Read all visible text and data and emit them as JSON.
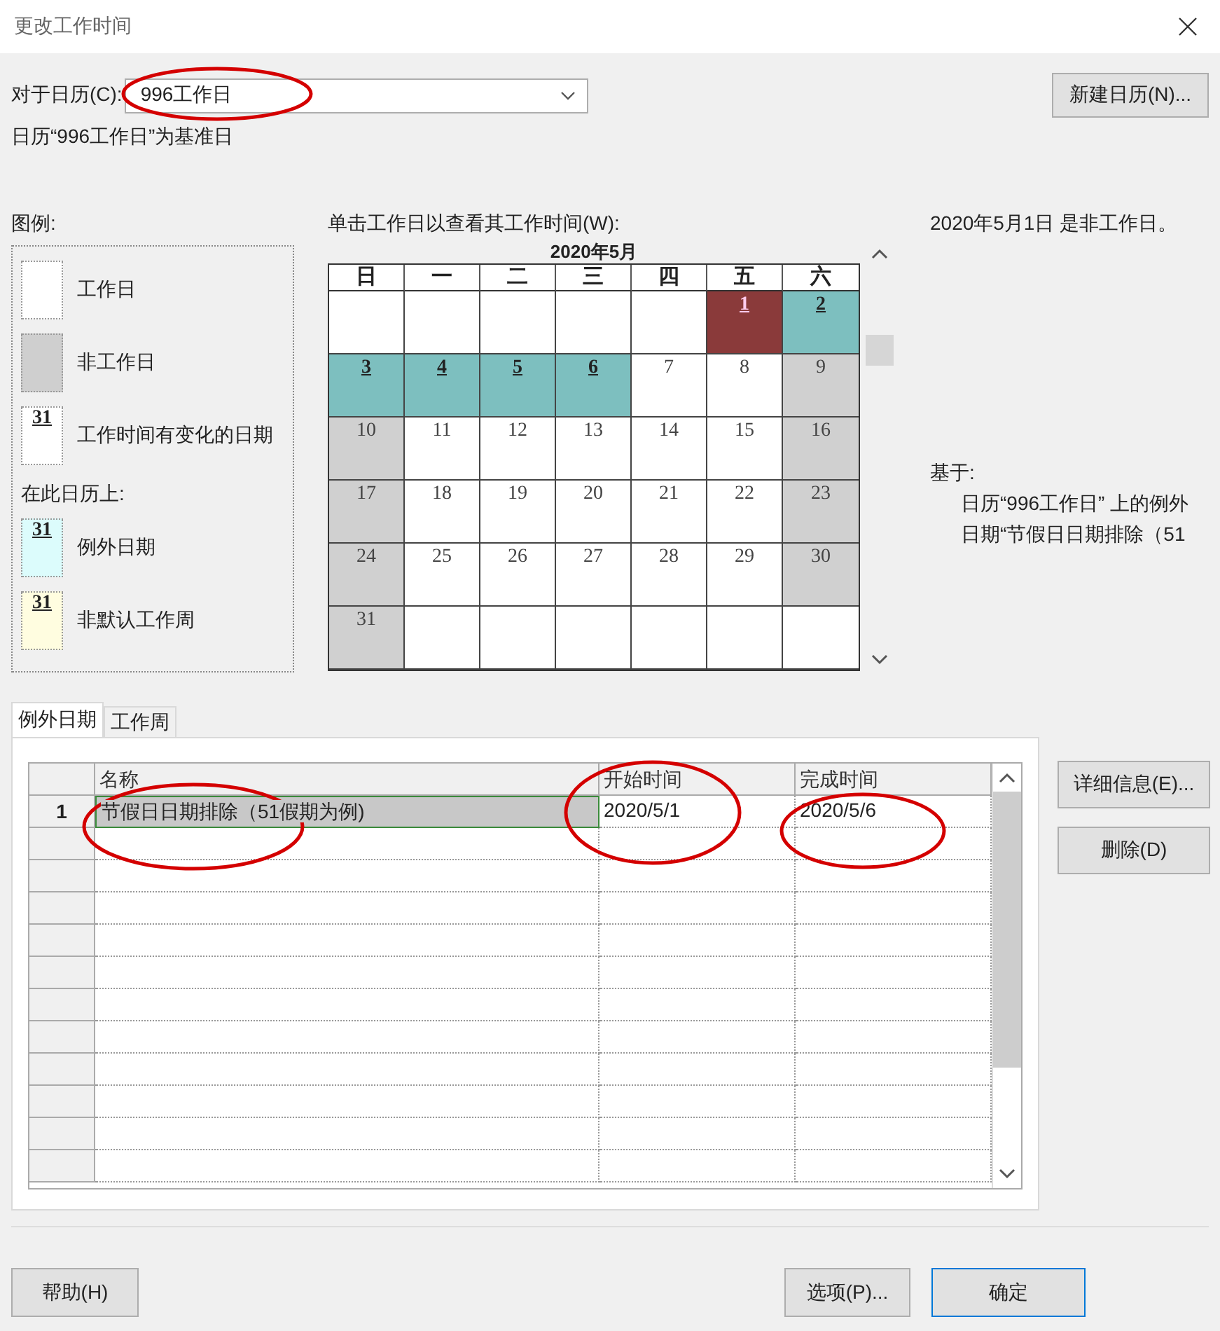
{
  "window": {
    "title": "更改工作时间"
  },
  "calendar_field": {
    "label": "对于日历(C):",
    "value": "996工作日",
    "annotated": true
  },
  "new_calendar_button": "新建日历(N)...",
  "basis_text": "日历“996工作日”为基准日",
  "legend": {
    "title": "图例:",
    "items": [
      {
        "kind": "work",
        "label": "工作日"
      },
      {
        "kind": "nonwork",
        "label": "非工作日"
      },
      {
        "kind": "changed",
        "sample": "31",
        "label": "工作时间有变化的日期"
      }
    ],
    "calendar_heading": "在此日历上:",
    "calendar_items": [
      {
        "kind": "exception",
        "sample": "31",
        "label": "例外日期"
      },
      {
        "kind": "nondefault",
        "sample": "31",
        "label": "非默认工作周"
      }
    ]
  },
  "calendar": {
    "instruction": "单击工作日以查看其工作时间(W):",
    "month": "2020年5月",
    "weekdays": [
      "日",
      "一",
      "二",
      "三",
      "四",
      "五",
      "六"
    ],
    "weeks": [
      [
        {
          "kind": "empty"
        },
        {
          "kind": "empty"
        },
        {
          "kind": "empty"
        },
        {
          "kind": "empty"
        },
        {
          "kind": "empty"
        },
        {
          "kind": "exception",
          "day": "1",
          "selected": true
        },
        {
          "kind": "exception",
          "day": "2",
          "selected": false
        }
      ],
      [
        {
          "kind": "exception",
          "day": "3",
          "selected": false
        },
        {
          "kind": "exception",
          "day": "4",
          "selected": false
        },
        {
          "kind": "exception",
          "day": "5",
          "selected": false
        },
        {
          "kind": "exception",
          "day": "6",
          "selected": false
        },
        {
          "kind": "work",
          "day": "7",
          "selected": false
        },
        {
          "kind": "work",
          "day": "8",
          "selected": false
        },
        {
          "kind": "nonwork",
          "day": "9",
          "selected": false
        }
      ],
      [
        {
          "kind": "nonwork",
          "day": "10",
          "selected": false
        },
        {
          "kind": "work",
          "day": "11",
          "selected": false
        },
        {
          "kind": "work",
          "day": "12",
          "selected": false
        },
        {
          "kind": "work",
          "day": "13",
          "selected": false
        },
        {
          "kind": "work",
          "day": "14",
          "selected": false
        },
        {
          "kind": "work",
          "day": "15",
          "selected": false
        },
        {
          "kind": "nonwork",
          "day": "16",
          "selected": false
        }
      ],
      [
        {
          "kind": "nonwork",
          "day": "17",
          "selected": false
        },
        {
          "kind": "work",
          "day": "18",
          "selected": false
        },
        {
          "kind": "work",
          "day": "19",
          "selected": false
        },
        {
          "kind": "work",
          "day": "20",
          "selected": false
        },
        {
          "kind": "work",
          "day": "21",
          "selected": false
        },
        {
          "kind": "work",
          "day": "22",
          "selected": false
        },
        {
          "kind": "nonwork",
          "day": "23",
          "selected": false
        }
      ],
      [
        {
          "kind": "nonwork",
          "day": "24",
          "selected": false
        },
        {
          "kind": "work",
          "day": "25",
          "selected": false
        },
        {
          "kind": "work",
          "day": "26",
          "selected": false
        },
        {
          "kind": "work",
          "day": "27",
          "selected": false
        },
        {
          "kind": "work",
          "day": "28",
          "selected": false
        },
        {
          "kind": "work",
          "day": "29",
          "selected": false
        },
        {
          "kind": "nonwork",
          "day": "30",
          "selected": false
        }
      ],
      [
        {
          "kind": "nonwork",
          "day": "31",
          "selected": false
        },
        {
          "kind": "empty"
        },
        {
          "kind": "empty"
        },
        {
          "kind": "empty"
        },
        {
          "kind": "empty"
        },
        {
          "kind": "empty"
        },
        {
          "kind": "empty"
        }
      ]
    ]
  },
  "day_info": {
    "status": "2020年5月1日 是非工作日。",
    "based_on_label": "基于:",
    "based_on_lines": [
      "日历“996工作日” 上的例外",
      "日期“节假日日期排除（51"
    ]
  },
  "tabs": [
    {
      "label": "例外日期",
      "selected": true
    },
    {
      "label": "工作周",
      "selected": false
    }
  ],
  "table": {
    "columns": [
      {
        "label": "名称",
        "annotated": true
      },
      {
        "label": "开始时间",
        "annotated": true
      },
      {
        "label": "完成时间",
        "annotated": true
      }
    ],
    "rows": [
      {
        "number": "1",
        "name": "节假日日期排除（51假期为例)",
        "start": "2020/5/1",
        "finish": "2020/5/6",
        "selected": true
      }
    ]
  },
  "side_buttons": [
    "详细信息(E)...",
    "删除(D)"
  ],
  "footer": {
    "help_button": "帮助(H)",
    "options_button": "选项(P)...",
    "ok_button": "确定"
  }
}
